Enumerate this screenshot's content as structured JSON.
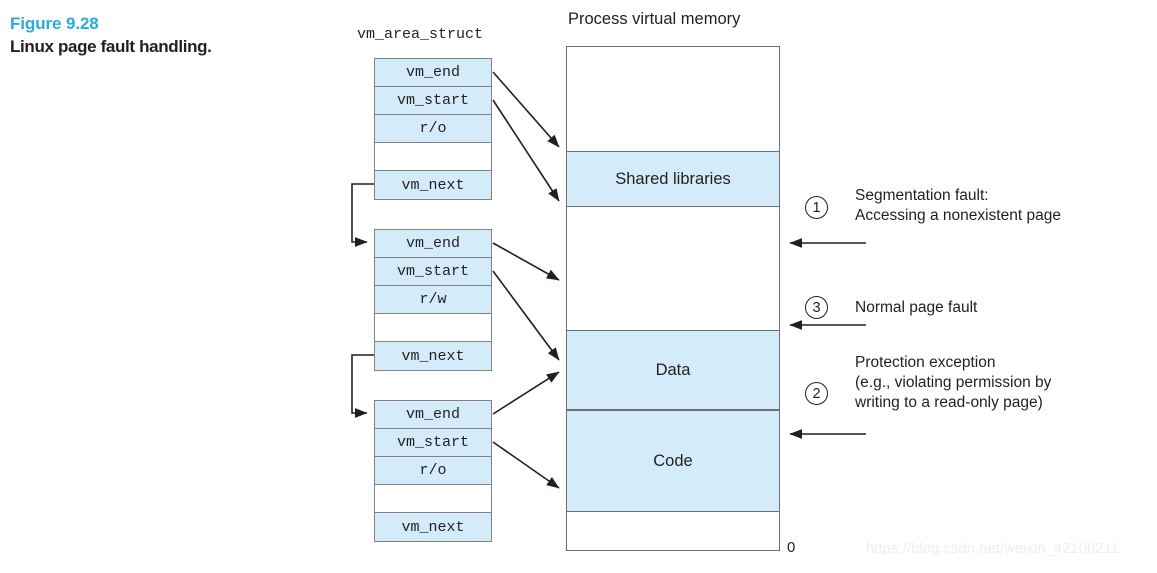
{
  "figure": {
    "number": "Figure 9.28",
    "title": "Linux page fault handling."
  },
  "struct_column": {
    "heading": "vm_area_struct",
    "blocks": [
      {
        "rows": [
          {
            "label": "vm_end",
            "filled": true
          },
          {
            "label": "vm_start",
            "filled": true
          },
          {
            "label": "r/o",
            "filled": true
          },
          {
            "label": "",
            "filled": false
          },
          {
            "label": "vm_next",
            "filled": true
          }
        ]
      },
      {
        "rows": [
          {
            "label": "vm_end",
            "filled": true
          },
          {
            "label": "vm_start",
            "filled": true
          },
          {
            "label": "r/w",
            "filled": true
          },
          {
            "label": "",
            "filled": false
          },
          {
            "label": "vm_next",
            "filled": true
          }
        ]
      },
      {
        "rows": [
          {
            "label": "vm_end",
            "filled": true
          },
          {
            "label": "vm_start",
            "filled": true
          },
          {
            "label": "r/o",
            "filled": true
          },
          {
            "label": "",
            "filled": false
          },
          {
            "label": "vm_next",
            "filled": true
          }
        ]
      }
    ]
  },
  "memory_column": {
    "heading": "Process virtual memory",
    "base_address_label": "0",
    "segments": [
      {
        "label": "",
        "filled": false
      },
      {
        "label": "Shared libraries",
        "filled": true
      },
      {
        "label": "",
        "filled": false
      },
      {
        "label": "Data",
        "filled": true
      },
      {
        "label": "Code",
        "filled": true
      },
      {
        "label": "",
        "filled": false
      }
    ]
  },
  "annotations": [
    {
      "number": "1",
      "lines": "Segmentation fault:\nAccessing a nonexistent page"
    },
    {
      "number": "3",
      "lines": "Normal page fault"
    },
    {
      "number": "2",
      "lines": "Protection exception\n(e.g., violating permission by\nwriting to a read-only page)"
    }
  ],
  "watermark": "https://blog.csdn.net/weixin_42100211",
  "colors": {
    "accent": "#29abe2",
    "fill": "#d4ecf9",
    "stroke": "#6d6e71",
    "text": "#231f20"
  }
}
